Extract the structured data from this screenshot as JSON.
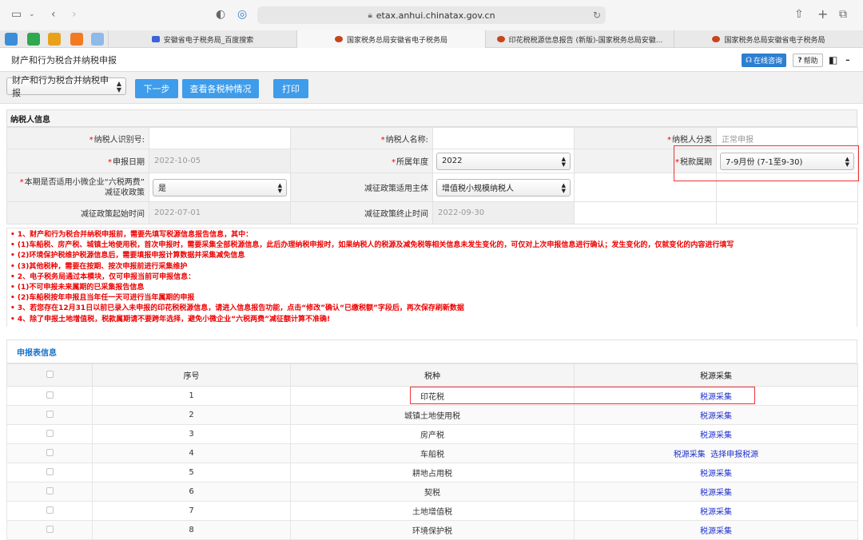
{
  "browser": {
    "url": "etax.anhui.chinatax.gov.cn",
    "tabs": [
      {
        "label": "安徽省电子税务局_百度搜索"
      },
      {
        "label": "国家税务总局安徽省电子税务局"
      },
      {
        "label": "印花税税源信息报告 (新版)-国家税务总局安徽..."
      },
      {
        "label": "国家税务总局安徽省电子税务局"
      }
    ]
  },
  "header": {
    "title": "财产和行为税合并纳税申报",
    "online_label": "在线咨询",
    "help_label": "帮助"
  },
  "actions": {
    "type_select": "财产和行为税合并纳税申报",
    "next_label": "下一步",
    "view_label": "查看各税种情况",
    "print_label": "打印"
  },
  "taxpayer": {
    "section_title": "纳税人信息",
    "id_label": "纳税人识别号:",
    "name_label": "纳税人名称:",
    "category_label": "纳税人分类",
    "category_value": "正常申报",
    "date_label": "申报日期",
    "date_value": "2022-10-05",
    "year_label": "所属年度",
    "year_value": "2022",
    "period_label": "税款属期",
    "period_value": "7-9月份 (7-1至9-30)",
    "sixtax_label_1": "本期是否适用小微企业“六税两费”",
    "sixtax_label_2": "减征收政策",
    "sixtax_value": "是",
    "subject_label": "减征政策适用主体",
    "subject_value": "增值税小规模纳税人",
    "start_label": "减征政策起始时间",
    "start_value": "2022-07-01",
    "end_label": "减征政策终止时间",
    "end_value": "2022-09-30"
  },
  "notes": [
    "• 1、财产和行为税合并纳税申报前，需要先填写税源信息报告信息，其中：",
    "• (1)车船税、房产税、城镇土地使用税，首次申报时，需要采集全部税源信息，此后办理纳税申报时，如果纳税人的税源及减免税等相关信息未发生变化的，可仅对上次申报信息进行确认；发生变化的，仅就变化的内容进行填写",
    "• (2)环境保护税维护税源信息后，需要填报申报计算数据并采集减免信息",
    "• (3)其他税种，需要在按期、按次申报前进行采集维护",
    "• 2、电子税务局通过本模块，仅可申报当前可申报信息：",
    "• (1)不可申报未来属期的已采集报告信息",
    "• (2)车船税按年申报且当年任一天可进行当年属期的申报",
    "• 3、若您存在12月31日以前已录入未申报的印花税税源信息，请进入信息报告功能，点击“修改”确认“已缴税额”字段后，再次保存刷新数据",
    "• 4、除了申报土地增值税，税款属期请不要跨年选择，避免小微企业“六税两费”减征额计算不准确!"
  ],
  "decl": {
    "section_title": "申报表信息",
    "columns": [
      "序号",
      "税种",
      "税源采集"
    ],
    "rows": [
      {
        "no": "1",
        "tax": "印花税",
        "link1": "税源采集",
        "link2": ""
      },
      {
        "no": "2",
        "tax": "城镇土地使用税",
        "link1": "税源采集",
        "link2": ""
      },
      {
        "no": "3",
        "tax": "房产税",
        "link1": "税源采集",
        "link2": ""
      },
      {
        "no": "4",
        "tax": "车船税",
        "link1": "税源采集",
        "link2": "选择申报税源"
      },
      {
        "no": "5",
        "tax": "耕地占用税",
        "link1": "税源采集",
        "link2": ""
      },
      {
        "no": "6",
        "tax": "契税",
        "link1": "税源采集",
        "link2": ""
      },
      {
        "no": "7",
        "tax": "土地增值税",
        "link1": "税源采集",
        "link2": ""
      },
      {
        "no": "8",
        "tax": "环境保护税",
        "link1": "税源采集",
        "link2": ""
      }
    ]
  },
  "colors": {
    "accent_blue": "#3e9cea",
    "warning_red": "#e00000",
    "link_blue": "#2233cc"
  }
}
